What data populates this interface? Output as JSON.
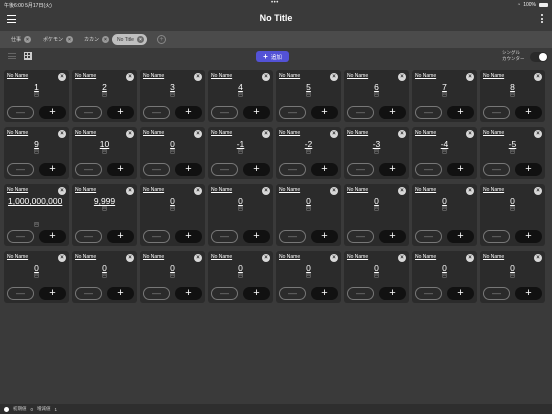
{
  "status": {
    "time": "午後6:00",
    "date": "5月17日(火)",
    "dots": "•••",
    "battery": "100%"
  },
  "nav": {
    "title": "No Title"
  },
  "tabs": [
    {
      "label": "仕事",
      "active": false
    },
    {
      "label": "ポケモン",
      "active": false
    },
    {
      "label": "カカン",
      "active": false
    },
    {
      "label": "No Title",
      "active": true
    }
  ],
  "tab_add": "+",
  "toolbar": {
    "add_label": "追加",
    "single_label_1": "シングル",
    "single_label_2": "カウンター",
    "single_on": true
  },
  "close_glyph": "×",
  "minus_glyph": "—",
  "plus_glyph": "+",
  "counters": [
    {
      "name": "No Name",
      "value": "1",
      "unit": "回"
    },
    {
      "name": "No Name",
      "value": "2",
      "unit": "回"
    },
    {
      "name": "No Name",
      "value": "3",
      "unit": "回"
    },
    {
      "name": "No Name",
      "value": "4",
      "unit": "回"
    },
    {
      "name": "No Name",
      "value": "5",
      "unit": "回"
    },
    {
      "name": "No Name",
      "value": "6",
      "unit": "回"
    },
    {
      "name": "No Name",
      "value": "7",
      "unit": "回"
    },
    {
      "name": "No Name",
      "value": "8",
      "unit": "回"
    },
    {
      "name": "No Name",
      "value": "9",
      "unit": "回"
    },
    {
      "name": "No Name",
      "value": "10",
      "unit": "回"
    },
    {
      "name": "No Name",
      "value": "0",
      "unit": "回"
    },
    {
      "name": "No Name",
      "value": "-1",
      "unit": "回"
    },
    {
      "name": "No Name",
      "value": "-2",
      "unit": "回"
    },
    {
      "name": "No Name",
      "value": "-3",
      "unit": "回"
    },
    {
      "name": "No Name",
      "value": "-4",
      "unit": "回"
    },
    {
      "name": "No Name",
      "value": "-5",
      "unit": "回"
    },
    {
      "name": "No Name",
      "value": "1,000,000,000",
      "unit": "回"
    },
    {
      "name": "No Name",
      "value": "9,999",
      "unit": "回"
    },
    {
      "name": "No Name",
      "value": "0",
      "unit": "回"
    },
    {
      "name": "No Name",
      "value": "0",
      "unit": "回"
    },
    {
      "name": "No Name",
      "value": "0",
      "unit": "回"
    },
    {
      "name": "No Name",
      "value": "0",
      "unit": "回"
    },
    {
      "name": "No Name",
      "value": "0",
      "unit": "回"
    },
    {
      "name": "No Name",
      "value": "0",
      "unit": "回"
    },
    {
      "name": "No Name",
      "value": "0",
      "unit": "回"
    },
    {
      "name": "No Name",
      "value": "0",
      "unit": "回"
    },
    {
      "name": "No Name",
      "value": "0",
      "unit": "回"
    },
    {
      "name": "No Name",
      "value": "0",
      "unit": "回"
    },
    {
      "name": "No Name",
      "value": "0",
      "unit": "回"
    },
    {
      "name": "No Name",
      "value": "0",
      "unit": "回"
    },
    {
      "name": "No Name",
      "value": "0",
      "unit": "回"
    },
    {
      "name": "No Name",
      "value": "0",
      "unit": "回"
    }
  ],
  "bottom": {
    "initial_label": "初期値",
    "initial_value": "0",
    "increment_label": "増減値",
    "increment_value": "1"
  },
  "colors": {
    "accent": "#5352d6",
    "background": "#3a3a3a",
    "card": "#2b2b2b"
  }
}
